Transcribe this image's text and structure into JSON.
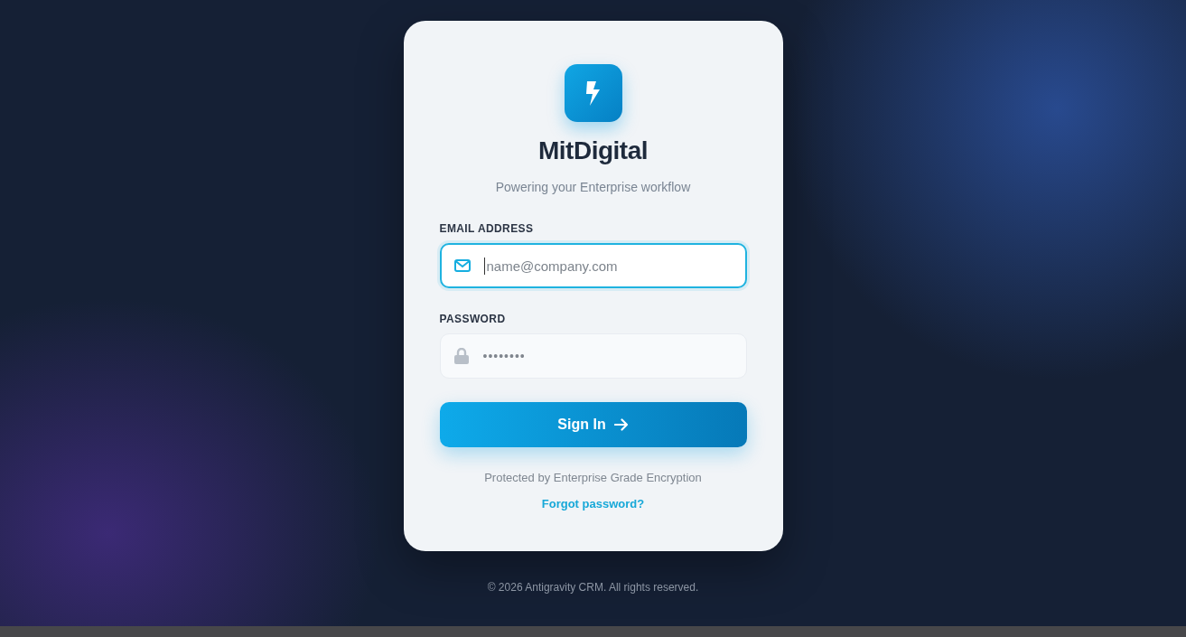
{
  "brand": {
    "name": "MitDigital",
    "tagline": "Powering your Enterprise workflow"
  },
  "fields": [
    {
      "kind": "email",
      "label": "EMAIL ADDRESS",
      "placeholder": "name@company.com",
      "focused": true
    },
    {
      "kind": "password",
      "label": "PASSWORD",
      "value": "••••••••",
      "focused": false
    }
  ],
  "submit": {
    "label": "Sign In"
  },
  "security_note": "Protected by Enterprise Grade Encryption",
  "forgot_link": "Forgot password?",
  "footer": "© 2026 Antigravity CRM. All rights reserved."
}
